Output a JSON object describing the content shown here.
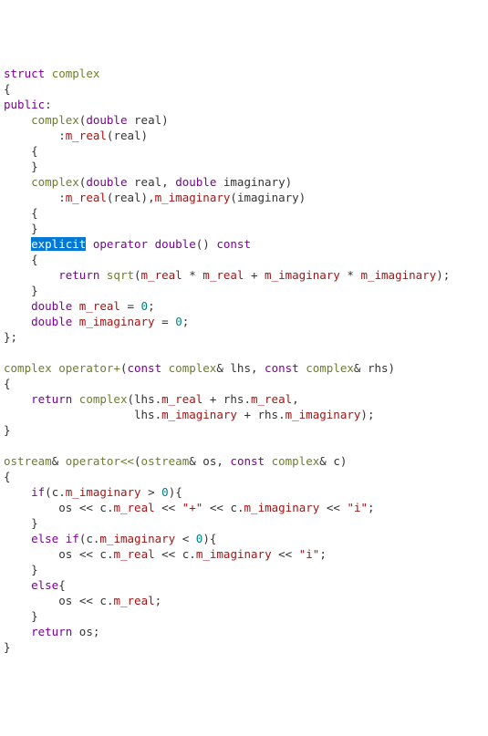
{
  "code": {
    "t_struct": "struct",
    "t_complex": "complex",
    "brace_open": "{",
    "brace_close": "}",
    "brace_close_semi": "};",
    "t_public": "public",
    "colon": ":",
    "t_double": "double",
    "p_real": "real",
    "p_imaginary": "imaginary",
    "m_real": "m_real",
    "m_imaginary": "m_imaginary",
    "t_explicit": "explicit",
    "t_operator": "operator",
    "t_const": "const",
    "t_return": "return",
    "fn_sqrt": "sqrt",
    "star": "*",
    "plus": "+",
    "eq": "=",
    "zero": "0",
    "semi": ";",
    "comma": ",",
    "amp": "&",
    "t_if": "if",
    "t_else": "else",
    "greater": ">",
    "less": "<",
    "t_ostream": "ostream",
    "p_os": "os",
    "p_lhs": "lhs",
    "p_rhs": "rhs",
    "p_c": "c",
    "dot": ".",
    "stream": "<<",
    "str_plus": "\"+\"",
    "str_i": "\"i\"",
    "paren_open": "(",
    "paren_close": ")",
    "operator_plus_name": "operator+",
    "operator_stream_name": "operator<<"
  }
}
